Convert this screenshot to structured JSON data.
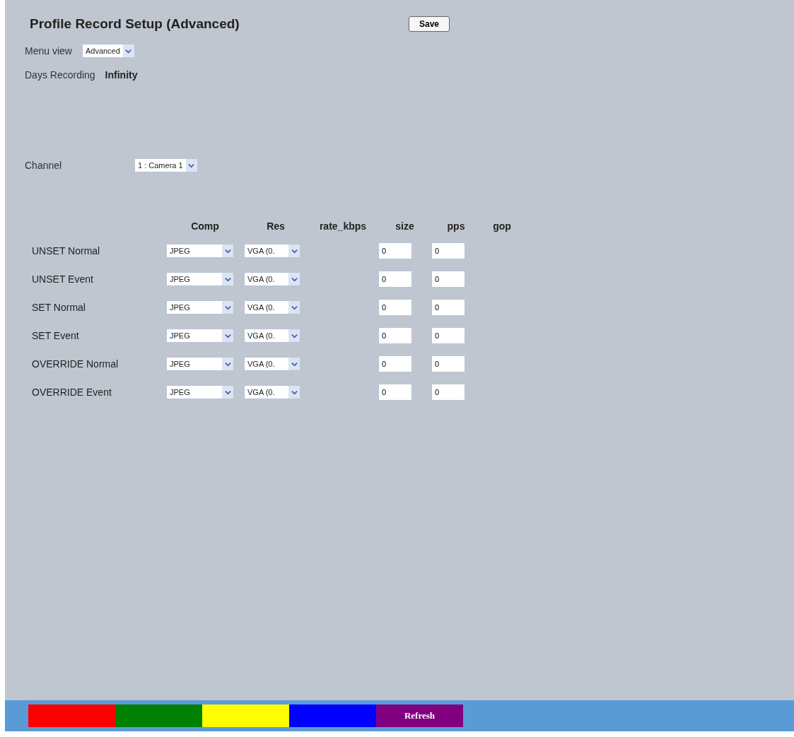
{
  "title": "Profile Record Setup (Advanced)",
  "save_button": "Save",
  "menu_view": {
    "label": "Menu view",
    "value": "Advanced"
  },
  "days_recording": {
    "label": "Days Recording",
    "value": "Infinity"
  },
  "channel": {
    "label": "Channel",
    "value": "1 : Camera 1"
  },
  "table": {
    "columns": [
      "Comp",
      "Res",
      "rate_kbps",
      "size",
      "pps",
      "gop"
    ],
    "groups": [
      {
        "rows": [
          {
            "label": "UNSET Normal",
            "comp": "JPEG",
            "res": "VGA (0.",
            "size": "0",
            "pps": "0"
          },
          {
            "label": "UNSET Event",
            "comp": "JPEG",
            "res": "VGA (0.",
            "size": "0",
            "pps": "0"
          }
        ]
      },
      {
        "rows": [
          {
            "label": "SET Normal",
            "comp": "JPEG",
            "res": "VGA (0.",
            "size": "0",
            "pps": "0"
          },
          {
            "label": "SET Event",
            "comp": "JPEG",
            "res": "VGA (0.",
            "size": "0",
            "pps": "0"
          }
        ]
      },
      {
        "rows": [
          {
            "label": "OVERRIDE Normal",
            "comp": "JPEG",
            "res": "VGA (0.",
            "size": "0",
            "pps": "0"
          },
          {
            "label": "OVERRIDE Event",
            "comp": "JPEG",
            "res": "VGA (0.",
            "size": "0",
            "pps": "0"
          }
        ]
      }
    ]
  },
  "bottom_bar": {
    "buttons": [
      {
        "color": "#ff0000"
      },
      {
        "color": "#008000"
      },
      {
        "color": "#ffff00"
      },
      {
        "color": "#0000ff"
      },
      {
        "color": "#800080",
        "label": "Refresh"
      }
    ]
  }
}
